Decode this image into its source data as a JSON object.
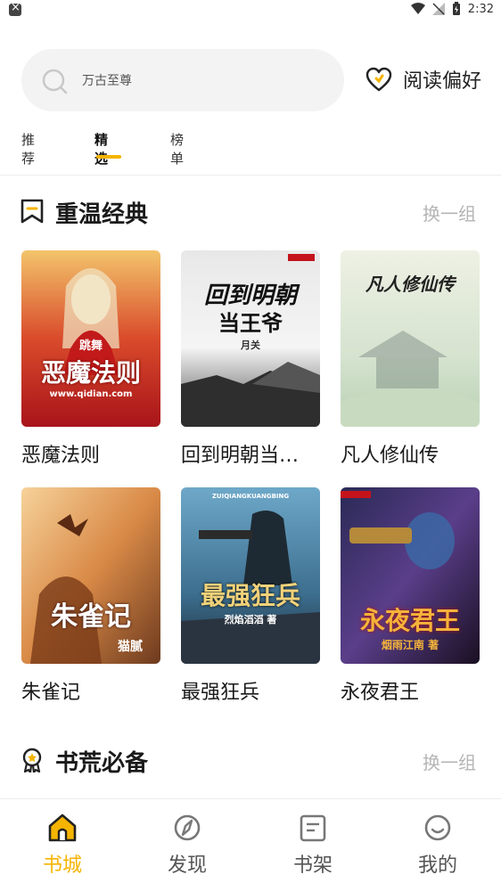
{
  "status": {
    "time": "2:32"
  },
  "search": {
    "placeholder": "万古至尊",
    "pref_label": "阅读偏好"
  },
  "tabs": [
    {
      "label": "推荐"
    },
    {
      "label": "精选"
    },
    {
      "label": "榜单"
    }
  ],
  "sections": [
    {
      "title": "重温经典",
      "action": "换一组",
      "books": [
        {
          "title": "恶魔法则",
          "cover_text": "恶魔法则",
          "cover_sub": "跳舞",
          "cover_url": "www.qidian.com"
        },
        {
          "title": "回到明朝当…",
          "cover_text": "回到明朝",
          "cover_sub": "当王爷",
          "cover_author": "月关"
        },
        {
          "title": "凡人修仙传",
          "cover_text": "凡人修仙传"
        },
        {
          "title": "朱雀记",
          "cover_text": "朱雀记",
          "cover_author": "猫腻"
        },
        {
          "title": "最强狂兵",
          "cover_text": "最强狂兵",
          "cover_sub": "ZUIQIANGKUANGBING",
          "cover_author": "烈焰滔滔 著"
        },
        {
          "title": "永夜君王",
          "cover_text": "永夜君王",
          "cover_author": "烟雨江南 著"
        }
      ]
    },
    {
      "title": "书荒必备",
      "action": "换一组"
    }
  ],
  "nav": [
    {
      "label": "书城",
      "icon": "home-icon"
    },
    {
      "label": "发现",
      "icon": "compass-icon"
    },
    {
      "label": "书架",
      "icon": "bookshelf-icon"
    },
    {
      "label": "我的",
      "icon": "smiley-icon"
    }
  ],
  "colors": {
    "accent": "#f5b400",
    "muted": "#b5b5b5",
    "search_bg": "#f3f3f3"
  }
}
